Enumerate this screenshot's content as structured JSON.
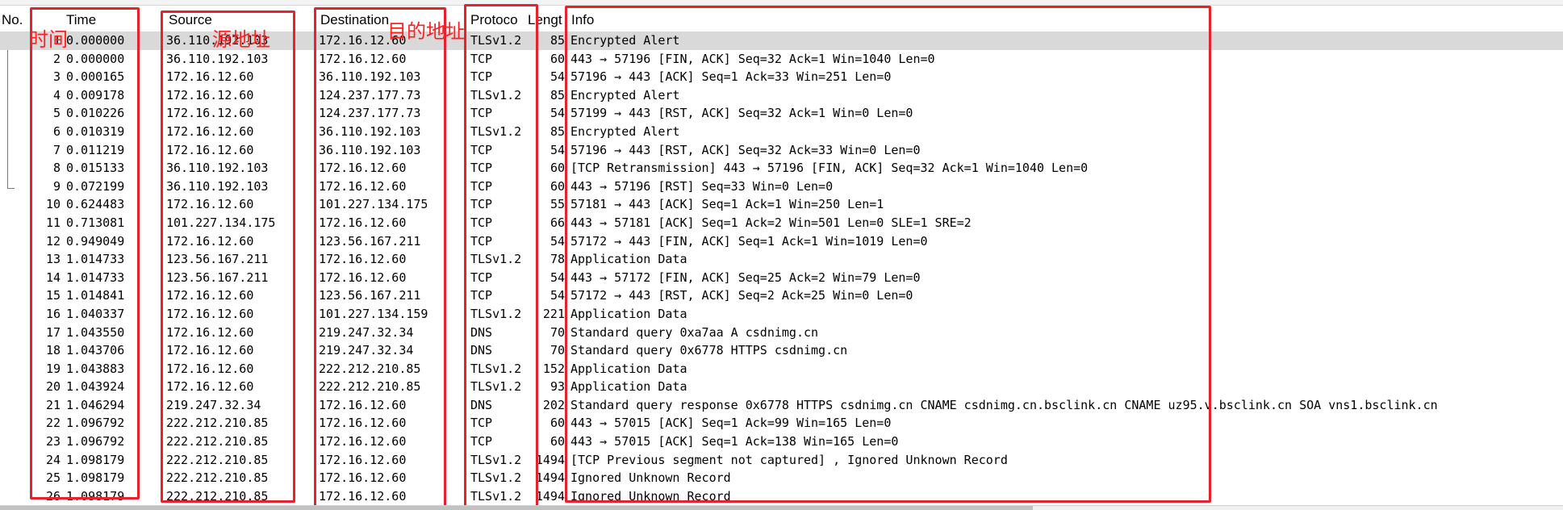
{
  "columns": {
    "no": "No.",
    "time": "Time",
    "source": "Source",
    "destination": "Destination",
    "protocol": "Protoco",
    "length": "Lengt",
    "info": "Info"
  },
  "annotations": {
    "time": "时间",
    "source": "源地址",
    "destination": "目的地址"
  },
  "colors": {
    "annotation": "#e8222a",
    "selected_row": "#d9d9d9"
  },
  "rows": [
    {
      "no": "1",
      "time": "0.000000",
      "source": "36.110.192.103",
      "destination": "172.16.12.60",
      "protocol": "TLSv1.2",
      "length": "85",
      "info": "Encrypted Alert",
      "selected": true
    },
    {
      "no": "2",
      "time": "0.000000",
      "source": "36.110.192.103",
      "destination": "172.16.12.60",
      "protocol": "TCP",
      "length": "60",
      "info": "443 → 57196 [FIN, ACK] Seq=32 Ack=1 Win=1040 Len=0"
    },
    {
      "no": "3",
      "time": "0.000165",
      "source": "172.16.12.60",
      "destination": "36.110.192.103",
      "protocol": "TCP",
      "length": "54",
      "info": "57196 → 443 [ACK] Seq=1 Ack=33 Win=251 Len=0"
    },
    {
      "no": "4",
      "time": "0.009178",
      "source": "172.16.12.60",
      "destination": "124.237.177.73",
      "protocol": "TLSv1.2",
      "length": "85",
      "info": "Encrypted Alert"
    },
    {
      "no": "5",
      "time": "0.010226",
      "source": "172.16.12.60",
      "destination": "124.237.177.73",
      "protocol": "TCP",
      "length": "54",
      "info": "57199 → 443 [RST, ACK] Seq=32 Ack=1 Win=0 Len=0"
    },
    {
      "no": "6",
      "time": "0.010319",
      "source": "172.16.12.60",
      "destination": "36.110.192.103",
      "protocol": "TLSv1.2",
      "length": "85",
      "info": "Encrypted Alert"
    },
    {
      "no": "7",
      "time": "0.011219",
      "source": "172.16.12.60",
      "destination": "36.110.192.103",
      "protocol": "TCP",
      "length": "54",
      "info": "57196 → 443 [RST, ACK] Seq=32 Ack=33 Win=0 Len=0"
    },
    {
      "no": "8",
      "time": "0.015133",
      "source": "36.110.192.103",
      "destination": "172.16.12.60",
      "protocol": "TCP",
      "length": "60",
      "info": "[TCP Retransmission] 443 → 57196 [FIN, ACK] Seq=32 Ack=1 Win=1040 Len=0"
    },
    {
      "no": "9",
      "time": "0.072199",
      "source": "36.110.192.103",
      "destination": "172.16.12.60",
      "protocol": "TCP",
      "length": "60",
      "info": "443 → 57196 [RST] Seq=33 Win=0 Len=0"
    },
    {
      "no": "10",
      "time": "0.624483",
      "source": "172.16.12.60",
      "destination": "101.227.134.175",
      "protocol": "TCP",
      "length": "55",
      "info": "57181 → 443 [ACK] Seq=1 Ack=1 Win=250 Len=1"
    },
    {
      "no": "11",
      "time": "0.713081",
      "source": "101.227.134.175",
      "destination": "172.16.12.60",
      "protocol": "TCP",
      "length": "66",
      "info": "443 → 57181 [ACK] Seq=1 Ack=2 Win=501 Len=0 SLE=1 SRE=2"
    },
    {
      "no": "12",
      "time": "0.949049",
      "source": "172.16.12.60",
      "destination": "123.56.167.211",
      "protocol": "TCP",
      "length": "54",
      "info": "57172 → 443 [FIN, ACK] Seq=1 Ack=1 Win=1019 Len=0"
    },
    {
      "no": "13",
      "time": "1.014733",
      "source": "123.56.167.211",
      "destination": "172.16.12.60",
      "protocol": "TLSv1.2",
      "length": "78",
      "info": "Application Data"
    },
    {
      "no": "14",
      "time": "1.014733",
      "source": "123.56.167.211",
      "destination": "172.16.12.60",
      "protocol": "TCP",
      "length": "54",
      "info": "443 → 57172 [FIN, ACK] Seq=25 Ack=2 Win=79 Len=0"
    },
    {
      "no": "15",
      "time": "1.014841",
      "source": "172.16.12.60",
      "destination": "123.56.167.211",
      "protocol": "TCP",
      "length": "54",
      "info": "57172 → 443 [RST, ACK] Seq=2 Ack=25 Win=0 Len=0"
    },
    {
      "no": "16",
      "time": "1.040337",
      "source": "172.16.12.60",
      "destination": "101.227.134.159",
      "protocol": "TLSv1.2",
      "length": "221",
      "info": "Application Data"
    },
    {
      "no": "17",
      "time": "1.043550",
      "source": "172.16.12.60",
      "destination": "219.247.32.34",
      "protocol": "DNS",
      "length": "70",
      "info": "Standard query 0xa7aa A csdnimg.cn"
    },
    {
      "no": "18",
      "time": "1.043706",
      "source": "172.16.12.60",
      "destination": "219.247.32.34",
      "protocol": "DNS",
      "length": "70",
      "info": "Standard query 0x6778 HTTPS csdnimg.cn"
    },
    {
      "no": "19",
      "time": "1.043883",
      "source": "172.16.12.60",
      "destination": "222.212.210.85",
      "protocol": "TLSv1.2",
      "length": "152",
      "info": "Application Data"
    },
    {
      "no": "20",
      "time": "1.043924",
      "source": "172.16.12.60",
      "destination": "222.212.210.85",
      "protocol": "TLSv1.2",
      "length": "93",
      "info": "Application Data"
    },
    {
      "no": "21",
      "time": "1.046294",
      "source": "219.247.32.34",
      "destination": "172.16.12.60",
      "protocol": "DNS",
      "length": "202",
      "info": "Standard query response 0x6778 HTTPS csdnimg.cn CNAME csdnimg.cn.bsclink.cn CNAME uz95.v.bsclink.cn SOA vns1.bsclink.cn"
    },
    {
      "no": "22",
      "time": "1.096792",
      "source": "222.212.210.85",
      "destination": "172.16.12.60",
      "protocol": "TCP",
      "length": "60",
      "info": "443 → 57015 [ACK] Seq=1 Ack=99 Win=165 Len=0"
    },
    {
      "no": "23",
      "time": "1.096792",
      "source": "222.212.210.85",
      "destination": "172.16.12.60",
      "protocol": "TCP",
      "length": "60",
      "info": "443 → 57015 [ACK] Seq=1 Ack=138 Win=165 Len=0"
    },
    {
      "no": "24",
      "time": "1.098179",
      "source": "222.212.210.85",
      "destination": "172.16.12.60",
      "protocol": "TLSv1.2",
      "length": "1494",
      "info": "[TCP Previous segment not captured] , Ignored Unknown Record"
    },
    {
      "no": "25",
      "time": "1.098179",
      "source": "222.212.210.85",
      "destination": "172.16.12.60",
      "protocol": "TLSv1.2",
      "length": "1494",
      "info": "Ignored Unknown Record"
    },
    {
      "no": "26",
      "time": "1.098179",
      "source": "222.212.210.85",
      "destination": "172.16.12.60",
      "protocol": "TLSv1.2",
      "length": "1494",
      "info": "Ignored Unknown Record"
    }
  ]
}
